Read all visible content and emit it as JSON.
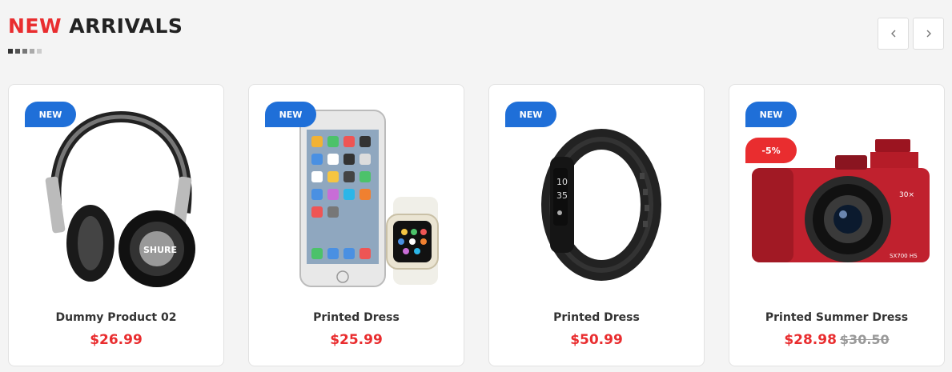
{
  "section": {
    "title_accent": "NEW",
    "title_main": "ARRIVALS",
    "dot_colors": [
      "#333333",
      "#555555",
      "#777777",
      "#aaaaaa",
      "#cccccc"
    ]
  },
  "nav": {
    "prev_icon": "chevron-left-icon",
    "next_icon": "chevron-right-icon"
  },
  "colors": {
    "accent": "#e92d2f",
    "badge_blue": "#1f6fd8"
  },
  "products": [
    {
      "name": "Dummy Product 02",
      "price": "$26.99",
      "old_price": "",
      "badge": "NEW",
      "discount": "",
      "image": "headphones"
    },
    {
      "name": "Printed Dress",
      "price": "$25.99",
      "old_price": "",
      "badge": "NEW",
      "discount": "",
      "image": "phone-and-watch"
    },
    {
      "name": "Printed Dress",
      "price": "$50.99",
      "old_price": "",
      "badge": "NEW",
      "discount": "",
      "image": "fitness-band"
    },
    {
      "name": "Printed Summer Dress",
      "price": "$28.98",
      "old_price": "$30.50",
      "badge": "NEW",
      "discount": "-5%",
      "image": "red-camera"
    }
  ]
}
